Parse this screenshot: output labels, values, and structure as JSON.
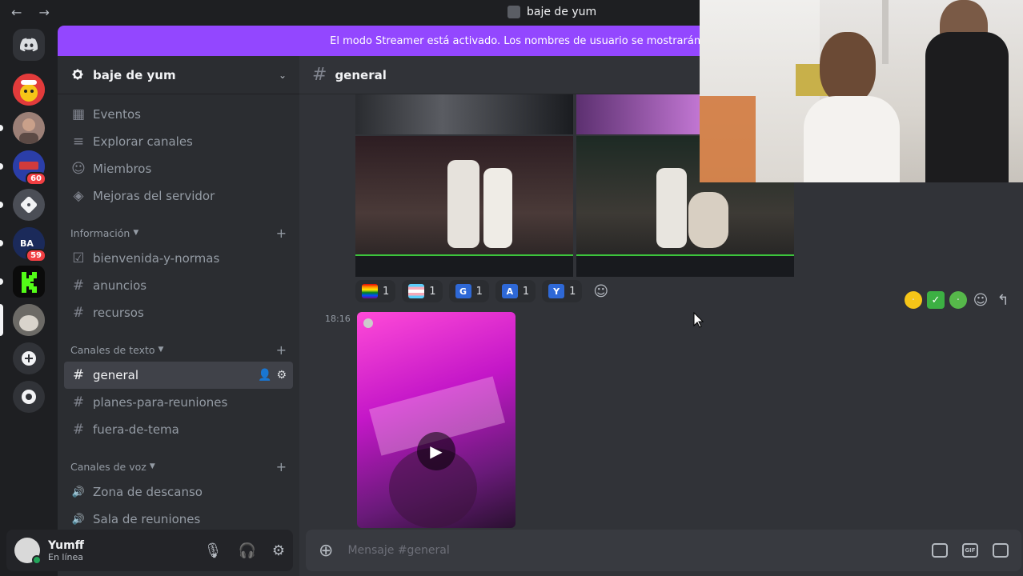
{
  "titlebar": {
    "title": "baje de yum",
    "nav": "← →"
  },
  "banner": {
    "text": "El modo Streamer está activado. Los nombres de usuario se mostrarán de forma"
  },
  "rail": {
    "servers": [
      {
        "id": "home",
        "icon": "discord-icon",
        "color": "#313338"
      },
      {
        "id": "clown",
        "icon": "clown-avatar",
        "color": "#e23b3b"
      },
      {
        "id": "user-face",
        "icon": "face-avatar",
        "color": "#8a6f68"
      },
      {
        "id": "league",
        "icon": "server-icon",
        "color": "#2b3ea8",
        "badge": "60"
      },
      {
        "id": "dice",
        "icon": "dice-icon",
        "color": "#4b4e56"
      },
      {
        "id": "bbc",
        "icon": "server-icon",
        "color": "#1b2a5a",
        "badge": "59"
      },
      {
        "id": "kick",
        "icon": "kick-icon",
        "color": "#111"
      },
      {
        "id": "cat",
        "icon": "cat-avatar",
        "color": "#5b5a57"
      }
    ]
  },
  "sidebar": {
    "server_name": "baje de yum",
    "top_items": [
      {
        "label": "Eventos",
        "icon": "▦"
      },
      {
        "label": "Explorar canales",
        "icon": "≡"
      },
      {
        "label": "Miembros",
        "icon": "☺"
      },
      {
        "label": "Mejoras del servidor",
        "icon": "◈"
      }
    ],
    "categories": [
      {
        "name": "Información",
        "channels": [
          {
            "label": "bienvenida-y-normas",
            "icon": "☑"
          },
          {
            "label": "anuncios",
            "icon": "#"
          },
          {
            "label": "recursos",
            "icon": "#"
          }
        ]
      },
      {
        "name": "Canales de texto",
        "channels": [
          {
            "label": "general",
            "icon": "#",
            "active": true
          },
          {
            "label": "planes-para-reuniones",
            "icon": "#"
          },
          {
            "label": "fuera-de-tema",
            "icon": "#"
          }
        ]
      },
      {
        "name": "Canales de voz",
        "channels": [
          {
            "label": "Zona de descanso",
            "icon": "🔊"
          },
          {
            "label": "Sala de reuniones",
            "icon": "🔊"
          }
        ]
      }
    ]
  },
  "user": {
    "name": "Yumff",
    "status": "En línea"
  },
  "chat": {
    "channel": "general",
    "reactions": [
      {
        "emoji": "rainbow-flag",
        "count": "1",
        "color": "#e04040"
      },
      {
        "emoji": "trans-flag",
        "count": "1",
        "color": "#7fc8f8"
      },
      {
        "emoji": "G",
        "count": "1",
        "color": "#2e68d6"
      },
      {
        "emoji": "A",
        "count": "1",
        "color": "#2e68d6"
      },
      {
        "emoji": "Y",
        "count": "1",
        "color": "#2e68d6"
      }
    ],
    "timestamp": "18:16",
    "placeholder": "Mensaje #general"
  }
}
